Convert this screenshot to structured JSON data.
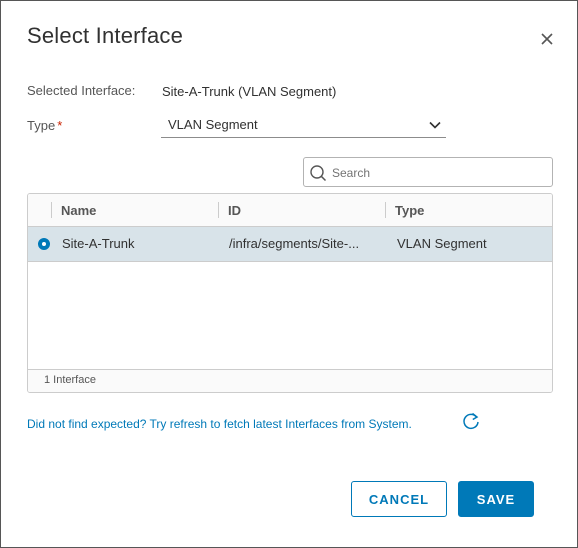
{
  "dialog": {
    "title": "Select Interface"
  },
  "selected": {
    "label": "Selected Interface:",
    "value": "Site-A-Trunk (VLAN Segment)"
  },
  "type": {
    "label": "Type",
    "required_mark": "*",
    "value": "VLAN Segment"
  },
  "search": {
    "placeholder": "Search"
  },
  "table": {
    "columns": [
      "Name",
      "ID",
      "Type"
    ],
    "rows": [
      {
        "selected": true,
        "name": "Site-A-Trunk",
        "id": "/infra/segments/Site-...",
        "type": "VLAN Segment"
      }
    ],
    "footer": "1 Interface"
  },
  "refresh": {
    "text": "Did not find expected? Try refresh to fetch latest Interfaces from System."
  },
  "buttons": {
    "cancel": "CANCEL",
    "save": "SAVE"
  },
  "colors": {
    "accent": "#0079b8",
    "selected_row": "#d8e3e9",
    "required": "#c92100"
  },
  "icons": {
    "close": "close-icon",
    "chevron": "chevron-down-icon",
    "search": "search-icon",
    "refresh": "refresh-icon"
  }
}
